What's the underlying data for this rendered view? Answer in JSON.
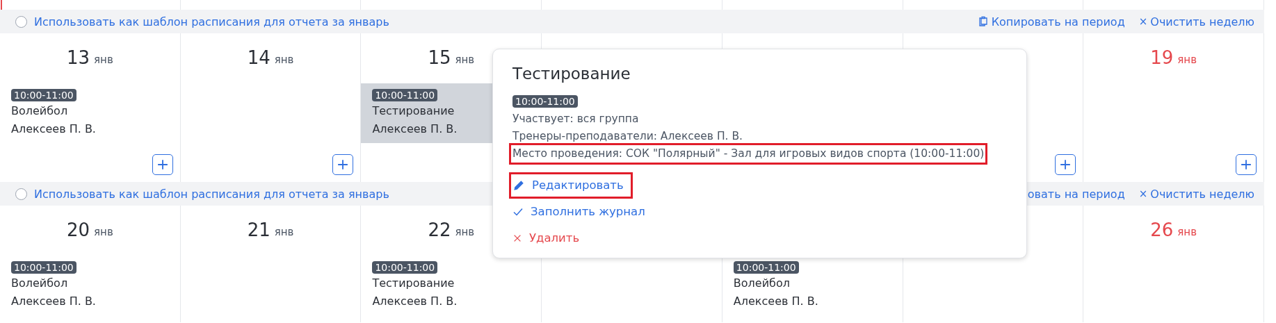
{
  "weeks": [
    {
      "template_label": "Использовать как шаблон расписания для отчета за январь",
      "template_checked": false,
      "copy_icon": true,
      "copy_label": "Копировать на период",
      "clear_icon": "×",
      "clear_label": "Очистить неделю",
      "days": [
        {
          "kind": "day",
          "number": "13",
          "month": "янв",
          "weekend": false,
          "add_button": true,
          "events": [
            {
              "time": "10:00-11:00",
              "title": "Волейбол",
              "coach": "Алексеев П. В.",
              "selected": false
            }
          ]
        },
        {
          "kind": "day",
          "number": "14",
          "month": "янв",
          "weekend": false,
          "add_button": true
        },
        {
          "kind": "day",
          "number": "15",
          "month": "янв",
          "weekend": false,
          "events": [
            {
              "time": "10:00-11:00",
              "title": "Тестирование",
              "coach": "Алексеев П. В.",
              "selected": true
            }
          ]
        },
        {
          "kind": "covered"
        },
        {
          "kind": "covered"
        },
        {
          "kind": "covered",
          "add_button": true
        },
        {
          "kind": "day",
          "number": "19",
          "month": "янв",
          "weekend": true,
          "add_button": true
        }
      ]
    },
    {
      "template_label": "Использовать как шаблон расписания для отчета за январь",
      "template_checked": false,
      "copy_label": "овать на период",
      "clear_icon": "×",
      "clear_label": "Очистить неделю",
      "days": [
        {
          "kind": "day",
          "number": "20",
          "month": "янв",
          "weekend": false,
          "events": [
            {
              "time": "10:00-11:00",
              "title": "Волейбол",
              "coach": "Алексеев П. В.",
              "selected": false
            }
          ]
        },
        {
          "kind": "day",
          "number": "21",
          "month": "янв",
          "weekend": false
        },
        {
          "kind": "day",
          "number": "22",
          "month": "янв",
          "weekend": false,
          "events": [
            {
              "time": "10:00-11:00",
              "title": "Тестирование",
              "coach": "Алексеев П. В.",
              "selected": false
            }
          ]
        },
        {
          "kind": "covered"
        },
        {
          "kind": "covered",
          "events": [
            {
              "time": "10:00-11:00",
              "title": "Волейбол",
              "coach": "Алексеев П. В.",
              "selected": false
            }
          ]
        },
        {
          "kind": "covered"
        },
        {
          "kind": "day",
          "number": "26",
          "month": "янв",
          "weekend": true
        }
      ]
    }
  ],
  "popup": {
    "title": "Тестирование",
    "time": "10:00-11:00",
    "lines": [
      {
        "text": "Участвует: вся группа",
        "highlighted": false
      },
      {
        "text": "Тренеры-преподаватели: Алексеев П. В.",
        "highlighted": false
      },
      {
        "text": "Место проведения: СОК \"Полярный\" - Зал для игровых видов спорта (10:00-11:00)",
        "highlighted": true
      }
    ],
    "actions": [
      {
        "kind": "edit",
        "label": "Редактировать",
        "highlighted": true
      },
      {
        "kind": "check",
        "label": "Заполнить журнал",
        "highlighted": false
      },
      {
        "kind": "delete",
        "label": "Удалить",
        "highlighted": false
      }
    ]
  }
}
